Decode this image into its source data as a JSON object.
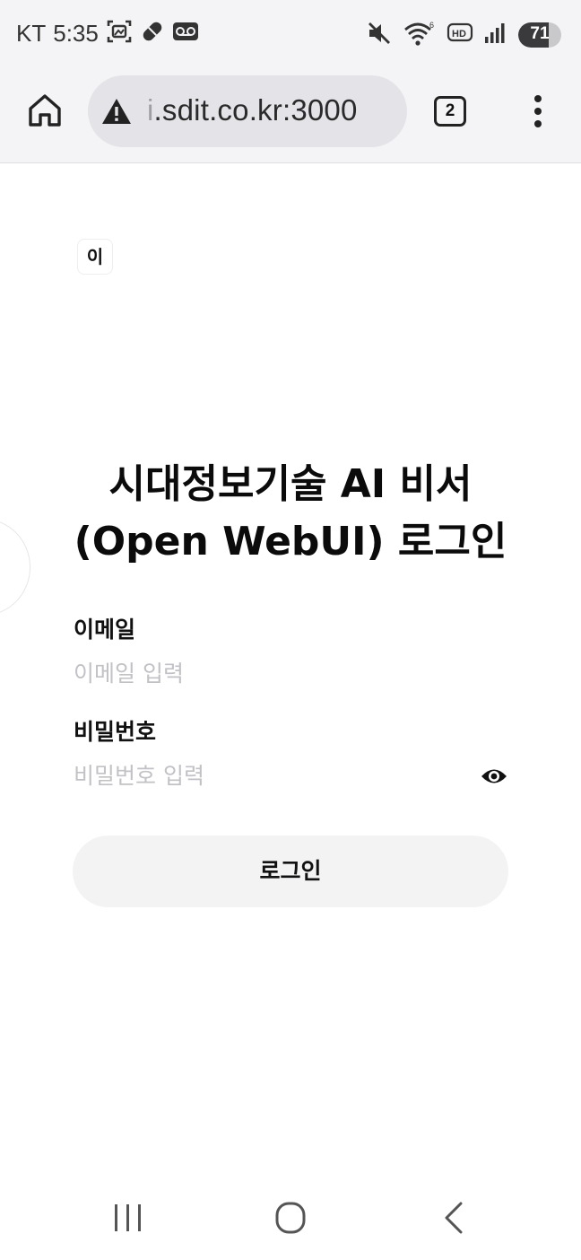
{
  "status_bar": {
    "carrier": "KT",
    "time": "5:35",
    "battery_level": "71",
    "battery_fraction": 0.71,
    "icons": [
      "screenshot-icon",
      "pill-icon",
      "voicemail-icon",
      "mute-icon",
      "wifi-icon",
      "hd-icon",
      "signal-icon",
      "battery-icon"
    ]
  },
  "browser": {
    "url_prefix": "i",
    "url_rest": ".sdit.co.kr:3000",
    "tab_count": "2",
    "icons": [
      "home-icon",
      "warning-icon",
      "tabs-icon",
      "more-vert-icon"
    ]
  },
  "page": {
    "logo_text": "이",
    "heading_line1": "시대정보기술 AI 비서",
    "heading_line2": "(Open WebUI) 로그인",
    "email": {
      "label": "이메일",
      "placeholder": "이메일 입력",
      "value": ""
    },
    "password": {
      "label": "비밀번호",
      "placeholder": "비밀번호 입력",
      "value": ""
    },
    "login_button": "로그인",
    "icons": [
      "eye-icon"
    ]
  },
  "nav_bar": {
    "icons": [
      "recent-apps-icon",
      "home-circle-icon",
      "back-icon"
    ]
  },
  "colors": {
    "status_bg": "#f4f4f6",
    "url_bar_bg": "#e4e4e8",
    "button_bg": "#f3f3f4",
    "placeholder": "#c2c2c6"
  }
}
